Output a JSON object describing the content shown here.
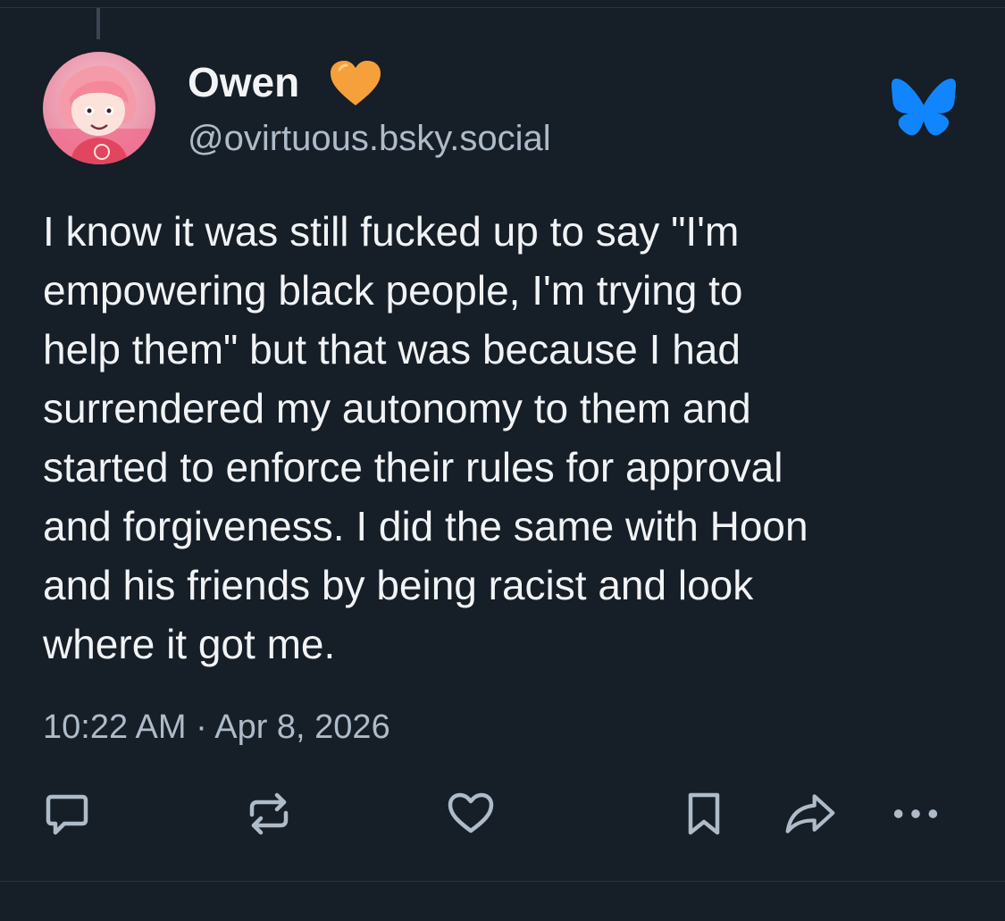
{
  "post": {
    "author_name": "Owen",
    "handle": "@ovirtuous.bsky.social",
    "text": "I know it was still fucked up to say \"I'm\nempowering black people, I'm trying to\nhelp them\" but that was because I had\nsurrendered my autonomy to them and\nstarted to enforce their rules for approval\nand forgiveness. I did the same with Hoon\nand his friends by being racist and look\nwhere it got me.",
    "timestamp": "10:22 AM · Apr 8, 2026"
  },
  "icons": {
    "name_badge": "orange-heart-icon",
    "app_logo": "bluesky-butterfly-icon",
    "actions": [
      "reply-icon",
      "repost-icon",
      "like-icon",
      "bookmark-icon",
      "share-icon",
      "more-icon"
    ]
  },
  "colors": {
    "background": "#161e27",
    "text": "#f1f3f5",
    "muted": "#aebbc9",
    "brand": "#1185fe",
    "heart": "#f5a03a"
  }
}
